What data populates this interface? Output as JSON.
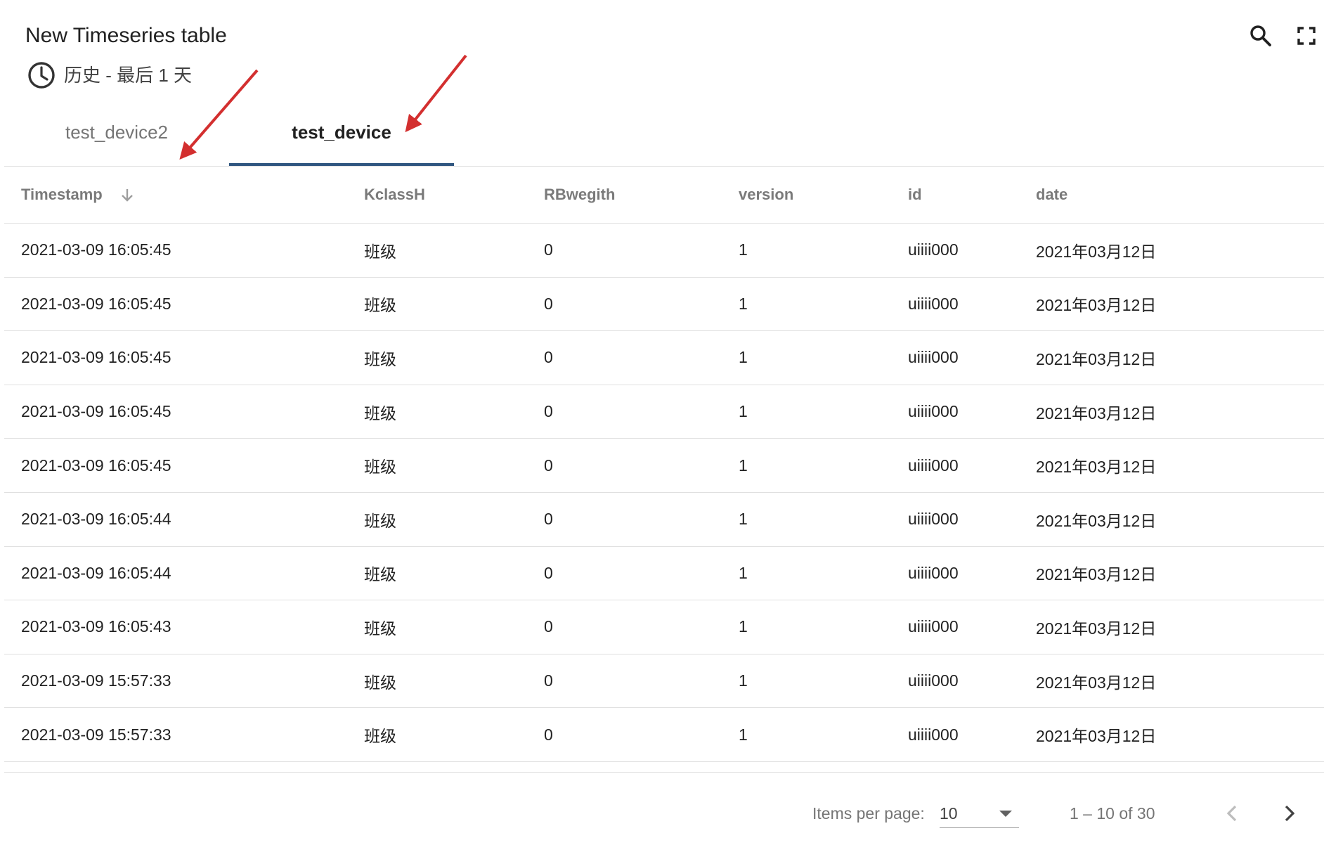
{
  "widget": {
    "title": "New Timeseries table",
    "timewindow": "历史 - 最后 1 天"
  },
  "icons": {
    "timewindow": "clock-icon",
    "search": "search-icon",
    "fullscreen": "fullscreen-icon",
    "sort": "arrow-down-icon",
    "page_size_dropdown": "dropdown-arrow-icon",
    "previous_page": "chevron-left-icon",
    "next_page": "chevron-right-icon"
  },
  "colors": {
    "tab_indicator": "#305680",
    "annotation_arrow": "#d32f2f",
    "header_text": "#757575"
  },
  "tabs": [
    {
      "label": "test_device2",
      "active": false
    },
    {
      "label": "test_device",
      "active": true
    }
  ],
  "table": {
    "columns": [
      "Timestamp",
      "KclassH",
      "RBwegith",
      "version",
      "id",
      "date"
    ],
    "sort": {
      "column": "Timestamp",
      "direction": "descending"
    },
    "rows": [
      [
        "2021-03-09 16:05:45",
        "班级",
        "0",
        "1",
        "uiiii000",
        "2021年03月12日"
      ],
      [
        "2021-03-09 16:05:45",
        "班级",
        "0",
        "1",
        "uiiii000",
        "2021年03月12日"
      ],
      [
        "2021-03-09 16:05:45",
        "班级",
        "0",
        "1",
        "uiiii000",
        "2021年03月12日"
      ],
      [
        "2021-03-09 16:05:45",
        "班级",
        "0",
        "1",
        "uiiii000",
        "2021年03月12日"
      ],
      [
        "2021-03-09 16:05:45",
        "班级",
        "0",
        "1",
        "uiiii000",
        "2021年03月12日"
      ],
      [
        "2021-03-09 16:05:44",
        "班级",
        "0",
        "1",
        "uiiii000",
        "2021年03月12日"
      ],
      [
        "2021-03-09 16:05:44",
        "班级",
        "0",
        "1",
        "uiiii000",
        "2021年03月12日"
      ],
      [
        "2021-03-09 16:05:43",
        "班级",
        "0",
        "1",
        "uiiii000",
        "2021年03月12日"
      ],
      [
        "2021-03-09 15:57:33",
        "班级",
        "0",
        "1",
        "uiiii000",
        "2021年03月12日"
      ],
      [
        "2021-03-09 15:57:33",
        "班级",
        "0",
        "1",
        "uiiii000",
        "2021年03月12日"
      ]
    ]
  },
  "pagination": {
    "items_per_page_label": "Items per page:",
    "page_size": "10",
    "range_label": "1 – 10 of 30",
    "previous_enabled": false,
    "next_enabled": true
  }
}
